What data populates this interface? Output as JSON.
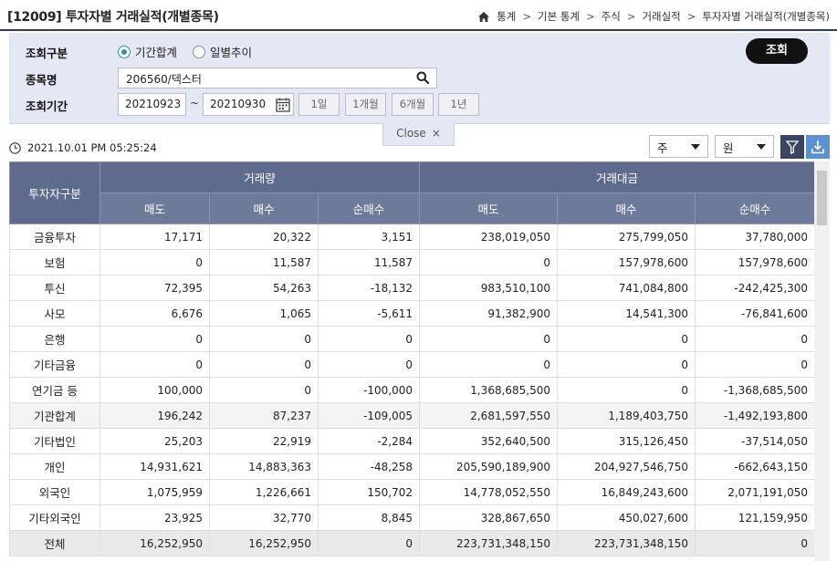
{
  "header": {
    "title": "[12009] 투자자별 거래실적(개별종목)",
    "breadcrumb": [
      "통계",
      "기본 통계",
      "주식",
      "거래실적",
      "투자자별 거래실적(개별종목)"
    ]
  },
  "search": {
    "query_type_label": "조회구분",
    "radio_period": "기간합계",
    "radio_daily": "일별추이",
    "stock_label": "종목명",
    "stock_value": "206560/덱스터",
    "date_label": "조회기간",
    "date_from": "20210923",
    "date_sep": "~",
    "date_to": "20210930",
    "period_buttons": [
      "1일",
      "1개월",
      "6개월",
      "1년"
    ],
    "query_button": "조회",
    "close_label": "Close",
    "close_symbol": "×"
  },
  "toolbar": {
    "timestamp": "2021.10.01 PM 05:25:24",
    "unit_volume": "주",
    "unit_amount": "원"
  },
  "table": {
    "header_investor": "투자자구분",
    "group_volume": "거래량",
    "group_amount": "거래대금",
    "sub_headers": [
      "매도",
      "매수",
      "순매수",
      "매도",
      "매수",
      "순매수"
    ],
    "rows": [
      {
        "name": "금융투자",
        "vals": [
          "17,171",
          "20,322",
          "3,151",
          "238,019,050",
          "275,799,050",
          "37,780,000"
        ]
      },
      {
        "name": "보험",
        "vals": [
          "0",
          "11,587",
          "11,587",
          "0",
          "157,978,600",
          "157,978,600"
        ]
      },
      {
        "name": "투신",
        "vals": [
          "72,395",
          "54,263",
          "-18,132",
          "983,510,100",
          "741,084,800",
          "-242,425,300"
        ]
      },
      {
        "name": "사모",
        "vals": [
          "6,676",
          "1,065",
          "-5,611",
          "91,382,900",
          "14,541,300",
          "-76,841,600"
        ]
      },
      {
        "name": "은행",
        "vals": [
          "0",
          "0",
          "0",
          "0",
          "0",
          "0"
        ]
      },
      {
        "name": "기타금융",
        "vals": [
          "0",
          "0",
          "0",
          "0",
          "0",
          "0"
        ]
      },
      {
        "name": "연기금 등",
        "vals": [
          "100,000",
          "0",
          "-100,000",
          "1,368,685,500",
          "0",
          "-1,368,685,500"
        ]
      },
      {
        "name": "기관합계",
        "vals": [
          "196,242",
          "87,237",
          "-109,005",
          "2,681,597,550",
          "1,189,403,750",
          "-1,492,193,800"
        ],
        "style": "subtotal"
      },
      {
        "name": "기타법인",
        "vals": [
          "25,203",
          "22,919",
          "-2,284",
          "352,640,500",
          "315,126,450",
          "-37,514,050"
        ]
      },
      {
        "name": "개인",
        "vals": [
          "14,931,621",
          "14,883,363",
          "-48,258",
          "205,590,189,900",
          "204,927,546,750",
          "-662,643,150"
        ]
      },
      {
        "name": "외국인",
        "vals": [
          "1,075,959",
          "1,226,661",
          "150,702",
          "14,778,052,550",
          "16,849,243,600",
          "2,071,191,050"
        ]
      },
      {
        "name": "기타외국인",
        "vals": [
          "23,925",
          "32,770",
          "8,845",
          "328,867,650",
          "450,027,600",
          "121,159,950"
        ]
      },
      {
        "name": "전체",
        "vals": [
          "16,252,950",
          "16,252,950",
          "0",
          "223,731,348,150",
          "223,731,348,150",
          "0"
        ],
        "style": "total"
      }
    ]
  }
}
